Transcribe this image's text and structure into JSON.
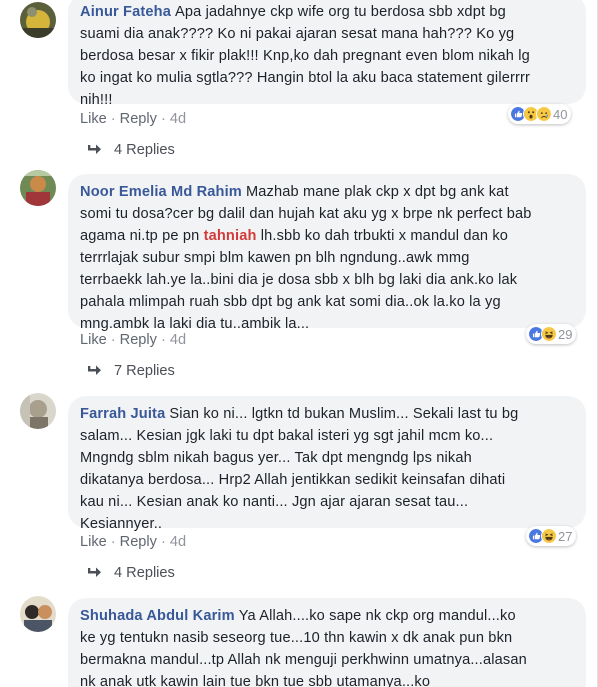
{
  "colors": {
    "name": "#385898",
    "bubble": "#f2f3f5",
    "meta": "#616770",
    "tag": "#d23b3b"
  },
  "comments": [
    {
      "author": "Ainur Fateha",
      "lines": [
        "Apa jadahnye ckp wife org tu berdosa sbb xdpt bg",
        "suami dia anak???? Ko ni pakai ajaran sesat mana hah??? Ko yg",
        "berdosa besar x fikir plak!!! Knp,ko dah pregnant even blom nikah lg",
        "ko ingat ko mulia sgtla??? Hangin btol la aku baca statement gilerrrr",
        "nih!!!"
      ],
      "like": "Like",
      "reply": "Reply",
      "time": "4d",
      "reactions": [
        "like-icon",
        "wow-icon",
        "sad-icon"
      ],
      "reaction_count": "40",
      "replies": "4 Replies"
    },
    {
      "author": "Noor Emelia Md Rahim",
      "lines": [
        "Mazhab mane plak ckp x dpt bg ank kat",
        "somi tu dosa?cer bg dalil dan hujah kat aku yg x brpe nk perfect bab",
        "agama ni.tp pe pn ",
        "terrrlajak subur smpi blm kawen pn blh ngndung..awk mmg",
        "terrbaekk lah.ye la..bini dia je dosa sbb x blh bg laki dia ank.ko lak",
        "pahala mlimpah ruah sbb dpt bg ank kat somi dia..ok la.ko la yg",
        "mng.ambk la laki dia tu..ambik la..."
      ],
      "tag": "tahniah",
      "line3_rest": " lh.sbb ko dah trbukti x mandul dan ko",
      "like": "Like",
      "reply": "Reply",
      "time": "4d",
      "reactions": [
        "like-icon",
        "haha-icon"
      ],
      "reaction_count": "29",
      "replies": "7 Replies"
    },
    {
      "author": "Farrah Juita",
      "lines": [
        "Sian ko ni... lgtkn td bukan Muslim... Sekali last tu bg",
        "salam... Kesian jgk laki tu dpt bakal isteri yg sgt jahil mcm ko...",
        "Mngndg sblm nikah bagus yer... Tak dpt mengndg lps nikah",
        "dikatanya berdosa... Hrp2 Allah jentikkan sedikit keinsafan dihati",
        "kau ni... Kesian anak ko nanti... Jgn ajar ajaran sesat tau...",
        "Kesiannyer.."
      ],
      "like": "Like",
      "reply": "Reply",
      "time": "4d",
      "reactions": [
        "like-icon",
        "haha-icon"
      ],
      "reaction_count": "27",
      "replies": "4 Replies"
    },
    {
      "author": "Shuhada Abdul Karim",
      "lines": [
        "Ya Allah....ko sape nk ckp org mandul...ko",
        "ke yg tentukn nasib seseorg tue...10 thn kawin x dk anak pun bkn",
        "bermakna mandul...tp Allah nk menguji perkhwinn umatnya...alasan",
        "nk anak utk kawin lain tue bkn tue sbb utamanya...ko"
      ]
    }
  ]
}
